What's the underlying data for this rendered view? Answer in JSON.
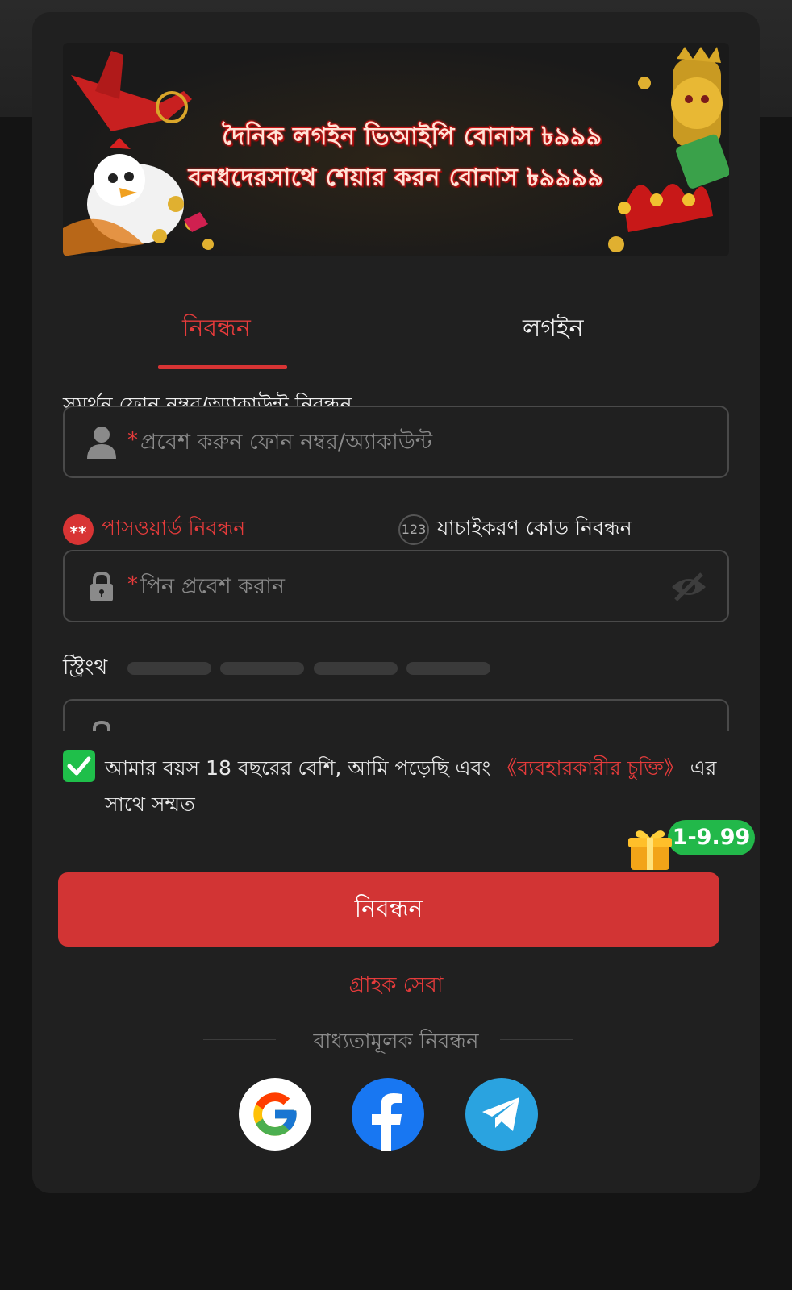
{
  "banner": {
    "line1": "দৈনিক লগইন ভিআইপি বোনাস ৳৯৯৯",
    "line2": "বনধদেরসাথে শেয়ার করন বোনাস ৳৯৯৯৯"
  },
  "tabs": [
    {
      "label": "নিবন্ধন",
      "active": true
    },
    {
      "label": "লগইন",
      "active": false
    }
  ],
  "account": {
    "section_label": "সমর্থন ফোন নম্বর/অ্যাকাউন্ট নিবন্ধন",
    "required_mark": "*",
    "placeholder": "প্রবেশ করুন ফোন নম্বর/অ্যাকাউন্ট"
  },
  "modes": {
    "password": {
      "icon_text": "**",
      "label": "পাসওয়ার্ড নিবন্ধন"
    },
    "code": {
      "icon_text": "123",
      "label": "যাচাইকরণ কোড নিবন্ধন"
    }
  },
  "password": {
    "required_mark": "*",
    "placeholder": "পিন প্রবেশ করান"
  },
  "strength": {
    "label": "স্ট্রিংথ",
    "level": 0,
    "segments": 4
  },
  "agreement": {
    "checked": true,
    "text_before": "আমার বয়স 18 বছরের বেশি, আমি পড়েছি এবং ",
    "link": "《ব্যবহারকারীর চুক্তি》",
    "text_after": " এর সাথে সম্মত"
  },
  "promo_badge": "1-9.99",
  "register_button": "নিবন্ধন",
  "customer_service": "গ্রাহক সেবা",
  "social": {
    "title": "বাধ্যতামূলক নিবন্ধন",
    "providers": [
      "google",
      "facebook",
      "telegram"
    ]
  },
  "colors": {
    "accent_red": "#d23434",
    "check_green": "#1fbf4a",
    "background": "#202020"
  }
}
